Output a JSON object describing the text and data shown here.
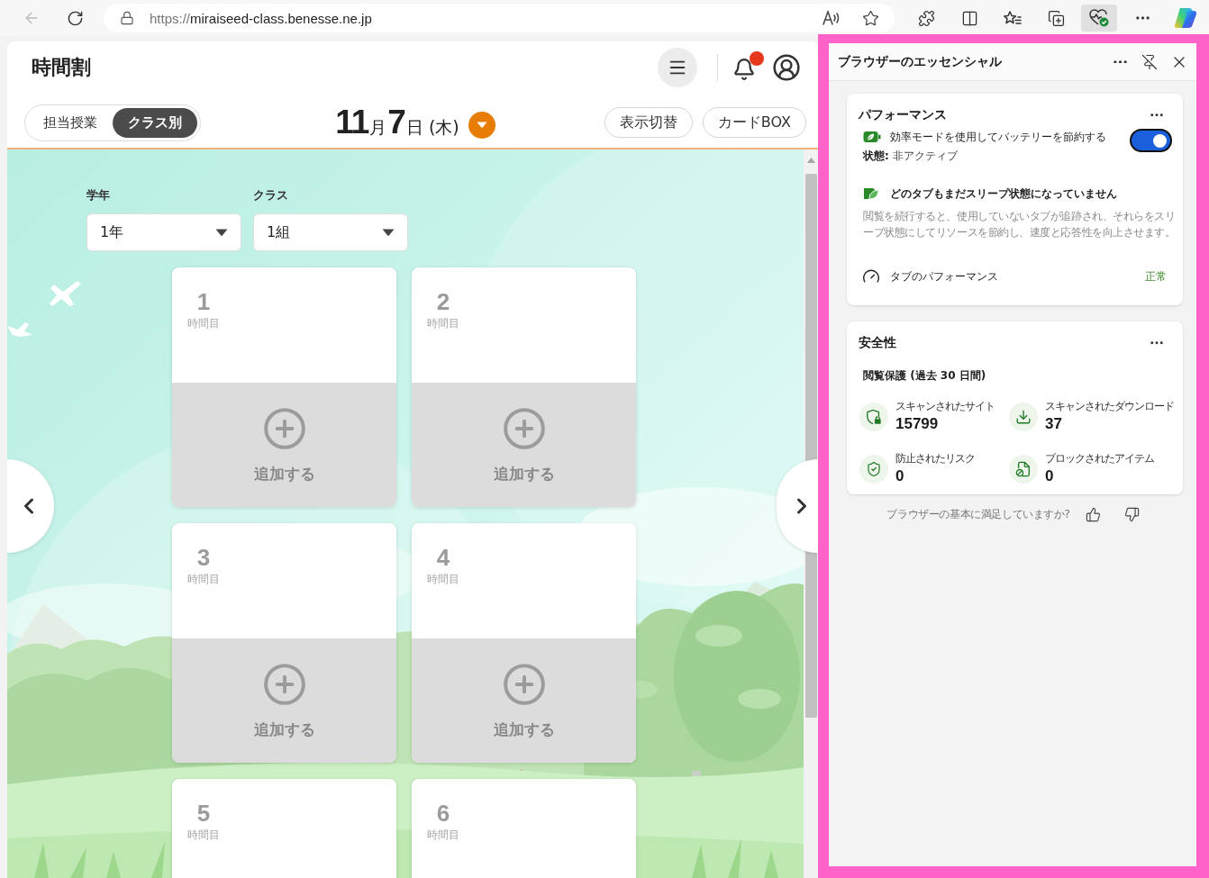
{
  "browser": {
    "back": {
      "disabled": true
    },
    "address": {
      "scheme": "https://",
      "host": "miraiseed-class.benesse.ne.jp"
    },
    "toolbar_buttons": [
      {
        "kind": "extensions",
        "selected": false
      },
      {
        "kind": "split-screen",
        "selected": false
      },
      {
        "kind": "favorites",
        "selected": false
      },
      {
        "kind": "collections",
        "selected": false
      },
      {
        "kind": "essentials",
        "selected": true
      },
      {
        "kind": "more",
        "selected": false
      },
      {
        "kind": "assistant",
        "selected": false
      }
    ]
  },
  "app": {
    "title": "時間割",
    "notifications": {
      "unread": true
    },
    "view_tabs": [
      {
        "label": "担当授業",
        "selected": false
      },
      {
        "label": "クラス別",
        "selected": true
      }
    ],
    "date": [
      {
        "text": "11",
        "kind": "number"
      },
      {
        "text": "月",
        "kind": "unit"
      },
      {
        "text": "7",
        "kind": "number"
      },
      {
        "text": "日",
        "kind": "unit"
      },
      {
        "text": "(木)",
        "kind": "weekday"
      }
    ],
    "buttons": [
      "表示切替",
      "カードBOX"
    ],
    "filters": [
      {
        "label": "学年",
        "value": "1年"
      },
      {
        "label": "クラス",
        "value": "1組"
      }
    ],
    "periods": [
      {
        "number": "1",
        "unit": "時間目",
        "action": "追加する"
      },
      {
        "number": "2",
        "unit": "時間目",
        "action": "追加する"
      },
      {
        "number": "3",
        "unit": "時間目",
        "action": "追加する"
      },
      {
        "number": "4",
        "unit": "時間目",
        "action": "追加する"
      },
      {
        "number": "5",
        "unit": "時間目"
      },
      {
        "number": "6",
        "unit": "時間目"
      }
    ]
  },
  "essentials": {
    "title": "ブラウザーのエッセンシャル",
    "performance": {
      "title": "パフォーマンス",
      "efficiency_mode": {
        "label": "効率モードを使用してバッテリーを節約する",
        "on": true,
        "status": "**状態:** 非アクティブ"
      },
      "sleeping_tabs": {
        "title": "どのタブもまだスリープ状態になっていません",
        "description": "閲覧を続行すると、使用していないタブが追跡され、それらをスリープ状態にしてリソースを節約し、速度と応答性を向上させます。"
      },
      "tab_performance": {
        "label": "タブのパフォーマンス",
        "status": "正常"
      }
    },
    "safety": {
      "title": "安全性",
      "subtitle": "閲覧保護 (過去 30 日間)",
      "stats": [
        {
          "kind": "site",
          "label": "スキャンされたサイト",
          "value": "15799"
        },
        {
          "kind": "download",
          "label": "スキャンされたダウンロード",
          "value": "37"
        },
        {
          "kind": "risk",
          "label": "防止されたリスク",
          "value": "0"
        },
        {
          "kind": "blocked",
          "label": "ブロックされたアイテム",
          "value": "0"
        }
      ]
    },
    "feedback": {
      "question": "ブラウザーの基本に満足していますか?"
    }
  }
}
